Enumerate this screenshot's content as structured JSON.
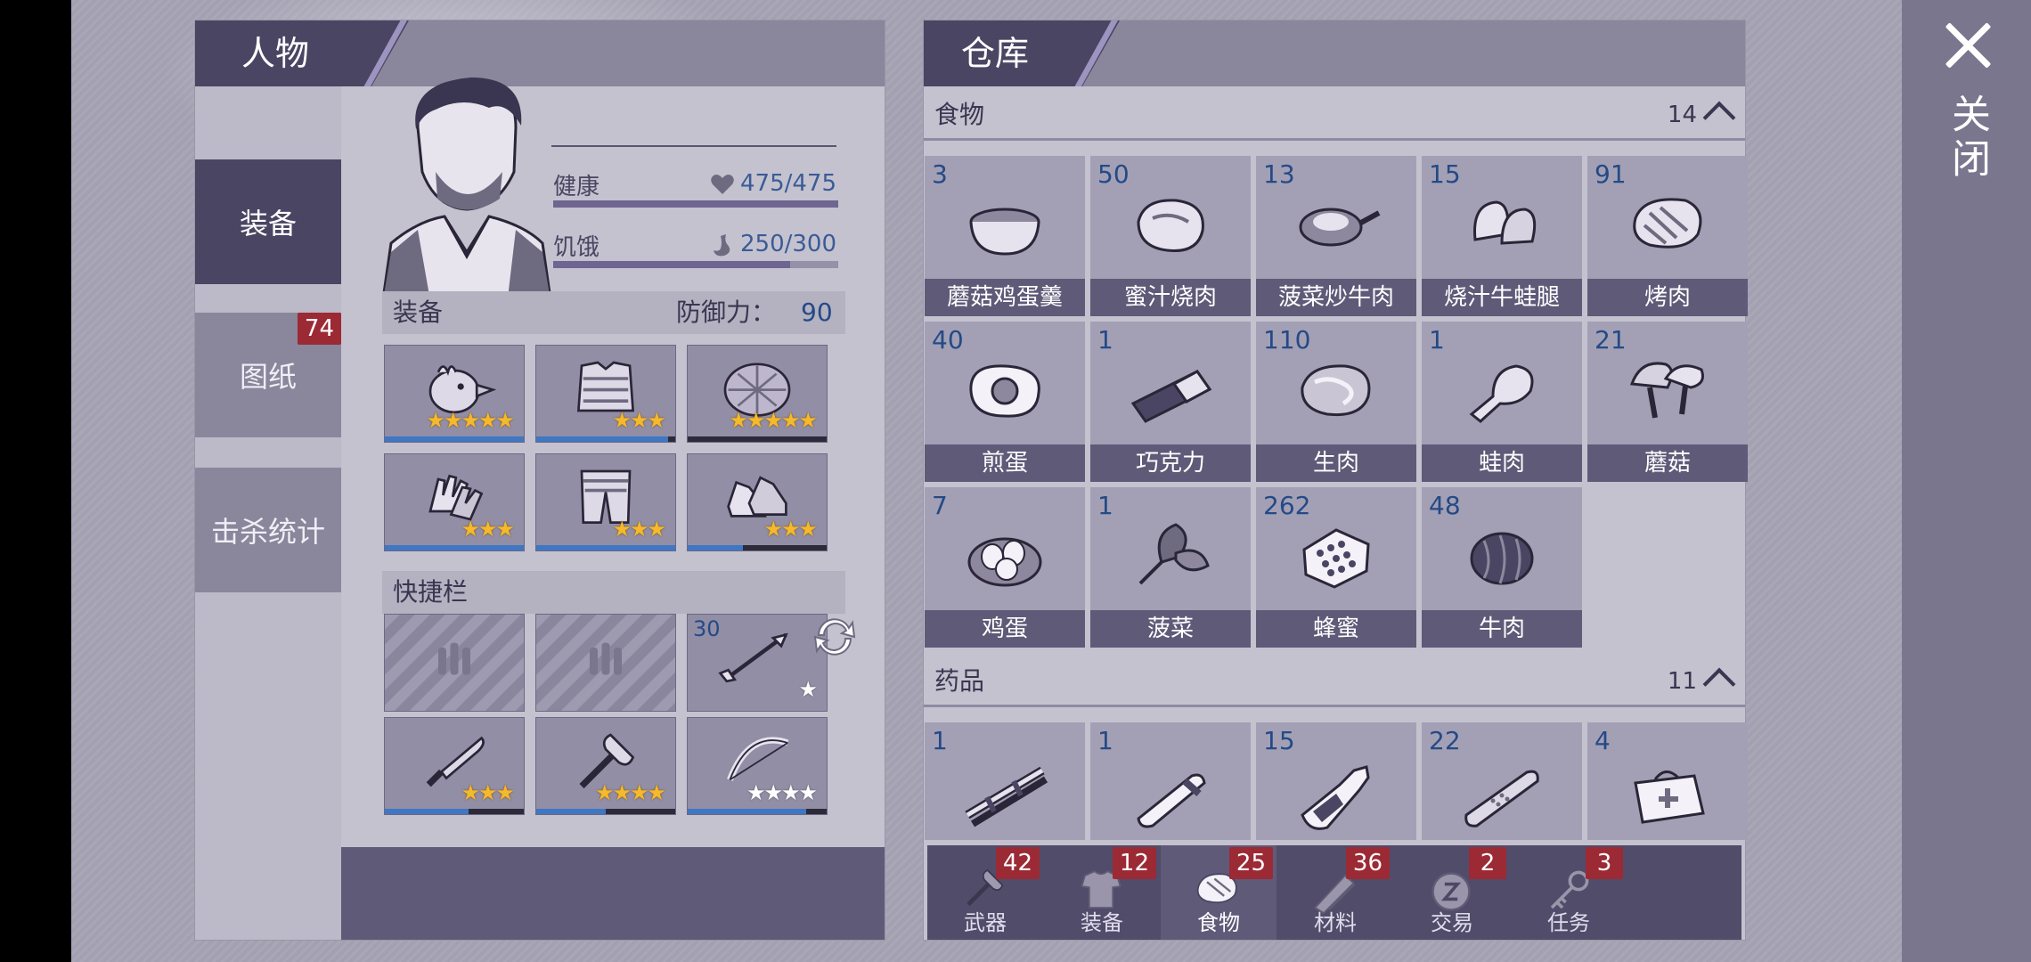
{
  "close": {
    "label": "关闭"
  },
  "character": {
    "title": "人物",
    "tabs": [
      {
        "label": "装备",
        "badge": ""
      },
      {
        "label": "图纸",
        "badge": "74"
      },
      {
        "label": "击杀统计",
        "badge": ""
      }
    ],
    "health": {
      "label": "健康",
      "value": "475/475",
      "fill": 1.0
    },
    "hunger": {
      "label": "饥饿",
      "value": "250/300",
      "fill": 0.83
    },
    "equipment": {
      "label": "装备",
      "defense_label": "防御力：",
      "defense_value": "90",
      "slots": [
        {
          "icon": "chicken-helmet-icon",
          "stars": 5,
          "durability": 1.0
        },
        {
          "icon": "armor-vest-icon",
          "stars": 3,
          "durability": 0.95
        },
        {
          "icon": "turtle-shell-icon",
          "stars": 5,
          "durability": 0.0
        },
        {
          "icon": "gloves-icon",
          "stars": 3,
          "durability": 1.0
        },
        {
          "icon": "armored-pants-icon",
          "stars": 3,
          "durability": 1.0
        },
        {
          "icon": "sneakers-icon",
          "stars": 3,
          "durability": 0.4
        }
      ]
    },
    "quickbar": {
      "label": "快捷栏",
      "slots": [
        {
          "icon": "empty-ammo-slot-icon",
          "count": "",
          "stars": 0,
          "white_stars": 0
        },
        {
          "icon": "empty-ammo-slot-icon",
          "count": "",
          "stars": 0,
          "white_stars": 0
        },
        {
          "icon": "arrow-icon",
          "count": "30",
          "stars": 0,
          "white_stars": 1
        },
        {
          "icon": "machete-icon",
          "count": "",
          "stars": 3,
          "white_stars": 0,
          "durability": 0.6
        },
        {
          "icon": "axe-icon",
          "count": "",
          "stars": 4,
          "white_stars": 0,
          "durability": 0.5
        },
        {
          "icon": "bow-icon",
          "count": "",
          "stars": 0,
          "white_stars": 4,
          "durability": 0.85
        }
      ]
    }
  },
  "warehouse": {
    "title": "仓库",
    "food": {
      "label": "食物",
      "count": "14",
      "items": [
        {
          "name": "蘑菇鸡蛋羹",
          "count": "3",
          "icon": "bowl-icon"
        },
        {
          "name": "蜜汁烧肉",
          "count": "50",
          "icon": "roast-meat-icon"
        },
        {
          "name": "菠菜炒牛肉",
          "count": "13",
          "icon": "frying-pan-icon"
        },
        {
          "name": "烧汁牛蛙腿",
          "count": "15",
          "icon": "frog-legs-icon"
        },
        {
          "name": "烤肉",
          "count": "91",
          "icon": "grilled-meat-icon"
        },
        {
          "name": "煎蛋",
          "count": "40",
          "icon": "fried-egg-icon"
        },
        {
          "name": "巧克力",
          "count": "1",
          "icon": "chocolate-icon"
        },
        {
          "name": "生肉",
          "count": "110",
          "icon": "raw-meat-icon"
        },
        {
          "name": "蛙肉",
          "count": "1",
          "icon": "frog-meat-icon"
        },
        {
          "name": "蘑菇",
          "count": "21",
          "icon": "mushroom-icon"
        },
        {
          "name": "鸡蛋",
          "count": "7",
          "icon": "eggs-nest-icon"
        },
        {
          "name": "菠菜",
          "count": "1",
          "icon": "spinach-icon"
        },
        {
          "name": "蜂蜜",
          "count": "262",
          "icon": "honeycomb-icon"
        },
        {
          "name": "牛肉",
          "count": "48",
          "icon": "beef-icon"
        }
      ]
    },
    "medicine": {
      "label": "药品",
      "count": "11",
      "items": [
        {
          "count": "1",
          "icon": "splint-icon"
        },
        {
          "count": "1",
          "icon": "test-tube-icon"
        },
        {
          "count": "15",
          "icon": "bottle-icon"
        },
        {
          "count": "22",
          "icon": "bandage-icon"
        },
        {
          "count": "4",
          "icon": "first-aid-bag-icon"
        }
      ]
    },
    "bottom_tabs": [
      {
        "label": "武器",
        "badge": "42",
        "icon": "axe-icon"
      },
      {
        "label": "装备",
        "badge": "12",
        "icon": "shirt-icon"
      },
      {
        "label": "食物",
        "badge": "25",
        "icon": "meat-icon",
        "active": true
      },
      {
        "label": "材料",
        "badge": "36",
        "icon": "wood-icon"
      },
      {
        "label": "交易",
        "badge": "2",
        "icon": "coin-icon"
      },
      {
        "label": "任务",
        "badge": "3",
        "icon": "key-icon"
      }
    ]
  }
}
